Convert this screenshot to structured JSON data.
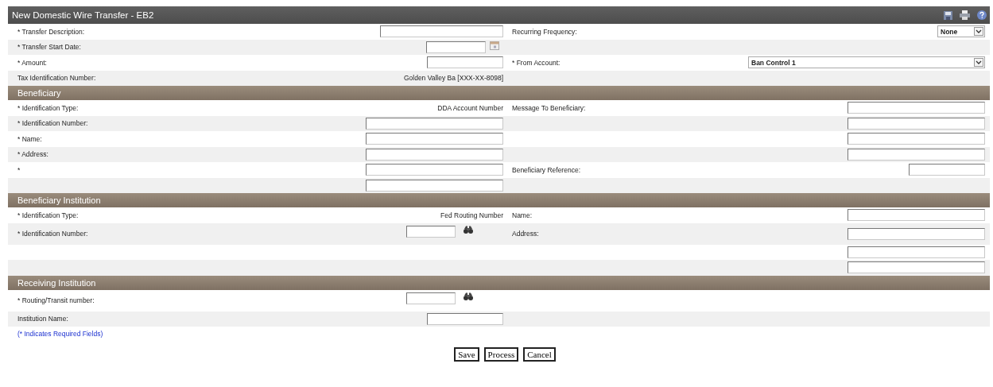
{
  "window": {
    "title": "New Domestic Wire Transfer - EB2"
  },
  "sections": [
    {
      "rows": [
        {
          "left": {
            "label": "* Transfer Description:",
            "kind": "longfield"
          },
          "right": {
            "label": "Recurring Frequency:",
            "kind": "select",
            "value": "None"
          }
        },
        {
          "left": {
            "label": "* Transfer Start Date:",
            "kind": "date"
          }
        },
        {
          "left": {
            "label": "* Amount:",
            "kind": "mediumfield"
          },
          "right": {
            "label": "* From Account:",
            "kind": "wideselect",
            "value": "Ban Control 1"
          }
        },
        {
          "left": {
            "label": "Tax Identification Number:",
            "kind": "text",
            "value": "Golden Valley Ba [XXX-XX-8098]"
          }
        }
      ]
    },
    {
      "title": "Beneficiary",
      "rows": [
        {
          "left": {
            "label": "* Identification Type:",
            "kind": "text",
            "value": "DDA Account Number"
          },
          "right": {
            "label": "Message To Beneficiary:",
            "kind": "field"
          }
        },
        {
          "left": {
            "label": "* Identification Number:",
            "kind": "field"
          },
          "right": {
            "kind": "field"
          }
        },
        {
          "left": {
            "label": "* Name:",
            "kind": "field"
          },
          "right": {
            "kind": "field"
          }
        },
        {
          "left": {
            "label": "* Address:",
            "kind": "field"
          },
          "right": {
            "kind": "field"
          }
        },
        {
          "left": {
            "label": "*",
            "kind": "field"
          },
          "right": {
            "label": "Beneficiary Reference:",
            "kind": "mediumfield"
          }
        },
        {
          "left": {
            "kind": "field"
          }
        }
      ]
    },
    {
      "title": "Beneficiary Institution",
      "rows": [
        {
          "left": {
            "label": "* Identification Type:",
            "kind": "text",
            "value": "Fed Routing Number"
          },
          "right": {
            "label": "Name:",
            "kind": "field"
          }
        },
        {
          "left": {
            "label": "* Identification Number:",
            "kind": "lookup"
          },
          "right": {
            "label": "Address:",
            "kind": "field"
          }
        },
        {
          "right": {
            "kind": "field"
          }
        },
        {
          "right": {
            "kind": "field"
          }
        }
      ]
    },
    {
      "title": "Receiving Institution",
      "rows": [
        {
          "left": {
            "label": "* Routing/Transit number:",
            "kind": "lookup"
          }
        },
        {
          "left": {
            "label": "Institution Name:",
            "kind": "mediumfield"
          }
        }
      ]
    }
  ],
  "note": "(* Indicates Required Fields)",
  "buttons": [
    "Save",
    "Process",
    "Cancel"
  ]
}
